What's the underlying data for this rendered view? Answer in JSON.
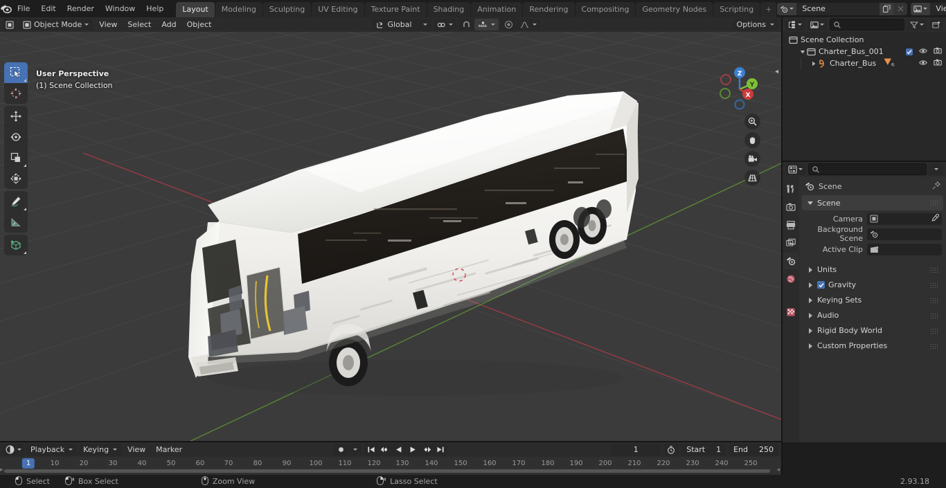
{
  "app": {
    "name": "Blender",
    "version": "2.93.18"
  },
  "topbar": {
    "menus": [
      "File",
      "Edit",
      "Render",
      "Window",
      "Help"
    ],
    "workspaces": [
      {
        "label": "Layout",
        "active": true
      },
      {
        "label": "Modeling",
        "active": false
      },
      {
        "label": "Sculpting",
        "active": false
      },
      {
        "label": "UV Editing",
        "active": false
      },
      {
        "label": "Texture Paint",
        "active": false
      },
      {
        "label": "Shading",
        "active": false
      },
      {
        "label": "Animation",
        "active": false
      },
      {
        "label": "Rendering",
        "active": false
      },
      {
        "label": "Compositing",
        "active": false
      },
      {
        "label": "Geometry Nodes",
        "active": false
      },
      {
        "label": "Scripting",
        "active": false
      }
    ],
    "add_workspace": "+",
    "scene_name": "Scene",
    "view_layer_name": "View Layer"
  },
  "viewport": {
    "header": {
      "mode": "Object Mode",
      "menus": [
        "View",
        "Select",
        "Add",
        "Object"
      ],
      "transform_orientation": "Global",
      "options": "Options"
    },
    "overlay": {
      "perspective": "User Perspective",
      "collection": "(1) Scene Collection"
    },
    "gizmo_axes": [
      "Z",
      "Y",
      "X"
    ],
    "colors": {
      "accent_blue": "#4772b3",
      "axis_x_red": "#cc3b3b",
      "axis_y_green": "#7cc03a",
      "axis_z_blue": "#3b7fd1",
      "background": "#3b3b3b"
    },
    "tools": [
      {
        "name": "tweak",
        "active": true
      },
      {
        "name": "cursor",
        "active": false
      },
      {
        "name": "move",
        "active": false
      },
      {
        "name": "rotate",
        "active": false
      },
      {
        "name": "scale",
        "active": false
      },
      {
        "name": "transform",
        "active": false
      },
      {
        "name": "annotate",
        "active": false
      },
      {
        "name": "measure",
        "active": false
      },
      {
        "name": "add-cube",
        "active": false
      }
    ]
  },
  "outliner": {
    "search_placeholder": "",
    "rows": [
      {
        "label": "Scene Collection",
        "depth": 0,
        "type": "collection",
        "expandable": false,
        "checkbox": false,
        "eye": false,
        "camera": false
      },
      {
        "label": "Charter_Bus_001",
        "depth": 1,
        "type": "collection",
        "expandable": true,
        "expanded": true,
        "checkbox": true,
        "eye": true,
        "camera": true
      },
      {
        "label": "Charter_Bus",
        "depth": 2,
        "type": "mesh",
        "expandable": true,
        "expanded": false,
        "checkbox": false,
        "eye": true,
        "camera": true,
        "badge": "63"
      }
    ]
  },
  "properties": {
    "search_placeholder": "",
    "breadcrumb": "Scene",
    "tabs": [
      {
        "name": "tool",
        "active": false
      },
      {
        "name": "render",
        "active": false
      },
      {
        "name": "output",
        "active": false
      },
      {
        "name": "view-layer",
        "active": false
      },
      {
        "name": "scene",
        "active": true
      },
      {
        "name": "world",
        "active": false
      },
      {
        "name": "texture",
        "active": false
      }
    ],
    "panel_scene": {
      "title": "Scene",
      "fields": [
        {
          "label": "Camera",
          "value": "",
          "icon": "camera-icon",
          "eyedropper": true
        },
        {
          "label": "Background Scene",
          "value": "",
          "icon": "scene-icon",
          "eyedropper": false
        },
        {
          "label": "Active Clip",
          "value": "",
          "icon": "clip-icon",
          "eyedropper": false
        }
      ]
    },
    "collapsed_panels": [
      {
        "label": "Units",
        "checkbox": false
      },
      {
        "label": "Gravity",
        "checkbox": true,
        "checked": true
      },
      {
        "label": "Keying Sets",
        "checkbox": false
      },
      {
        "label": "Audio",
        "checkbox": false
      },
      {
        "label": "Rigid Body World",
        "checkbox": false
      },
      {
        "label": "Custom Properties",
        "checkbox": false
      }
    ]
  },
  "timeline": {
    "controls": [
      "Playback",
      "Keying",
      "View",
      "Marker"
    ],
    "current_frame": "1",
    "start_label": "Start",
    "start_value": "1",
    "end_label": "End",
    "end_value": "250",
    "ticks": [
      10,
      20,
      30,
      40,
      50,
      60,
      70,
      80,
      90,
      100,
      110,
      120,
      130,
      140,
      150,
      160,
      170,
      180,
      190,
      200,
      210,
      220,
      230,
      240,
      250
    ],
    "playhead_frame": "1"
  },
  "statusbar": {
    "hints": [
      {
        "icon": "mouse-left-icon",
        "label": "Select"
      },
      {
        "icon": "mouse-left-drag-icon",
        "label": "Box Select"
      },
      {
        "icon": "mouse-middle-icon",
        "label": "Zoom View"
      },
      {
        "icon": "mouse-right-drag-icon",
        "label": "Lasso Select"
      }
    ],
    "version": "2.93.18"
  }
}
